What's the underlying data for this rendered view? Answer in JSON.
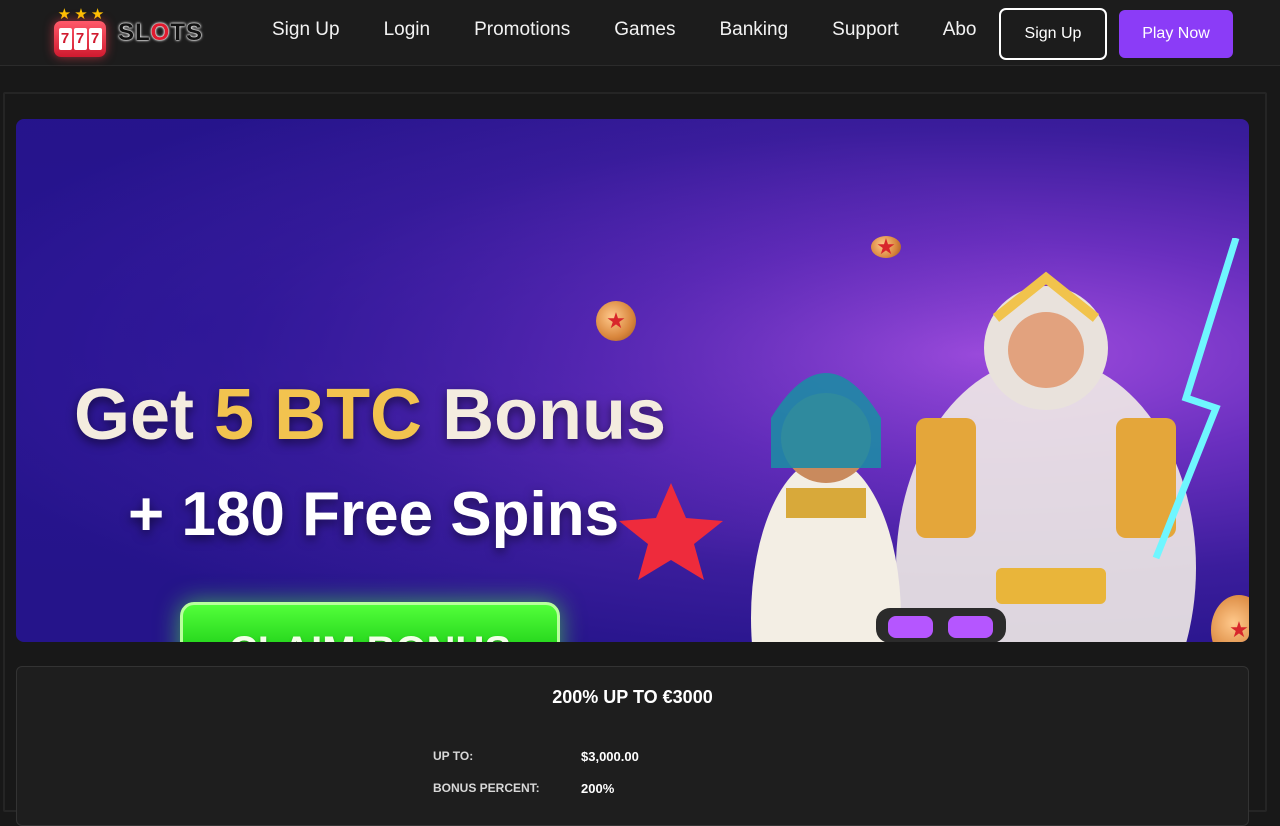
{
  "brand": {
    "name_pre": "SL",
    "name_o": "O",
    "name_post": "TS",
    "badge_digits": [
      "7",
      "7",
      "7"
    ]
  },
  "nav": {
    "items": [
      "Sign Up",
      "Login",
      "Promotions",
      "Games",
      "Banking",
      "Support",
      "About"
    ]
  },
  "header_actions": {
    "signup_label": "Sign Up",
    "play_label": "Play Now"
  },
  "banner": {
    "headline_pre": "Get ",
    "headline_gold": "5 BTC",
    "headline_post": " Bonus",
    "subline": "+ 180 Free Spins",
    "cta_label": "CLAIM BONUS"
  },
  "offer": {
    "title": "200% UP TO €3000",
    "rows": [
      {
        "label": "UP TO:",
        "value": "$3,000.00"
      },
      {
        "label": "BONUS PERCENT:",
        "value": "200%"
      }
    ]
  },
  "colors": {
    "accent": "#8b3cf7",
    "cta_green": "#16c712",
    "gold": "#f2c34f",
    "background": "#181818"
  }
}
